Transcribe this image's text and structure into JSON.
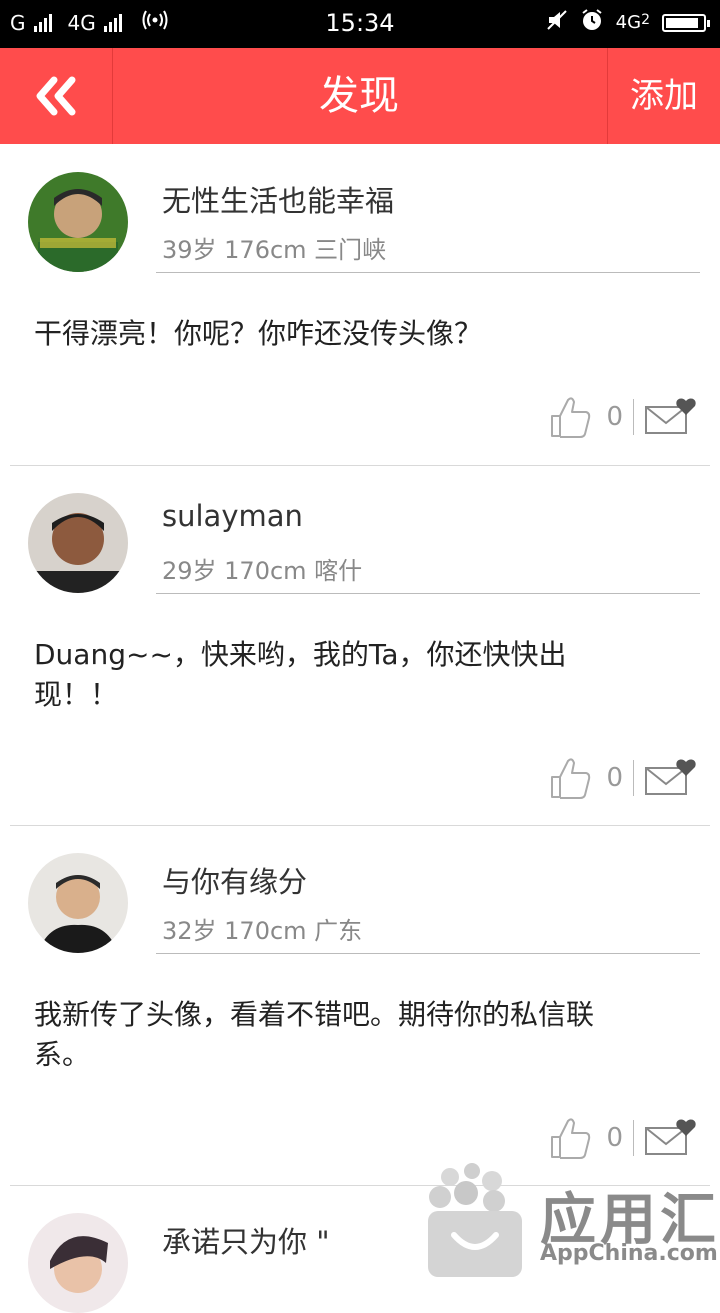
{
  "status_bar": {
    "carrier1": "G",
    "carrier2": "4G",
    "time": "15:34",
    "network_right": "4G",
    "network_right_sub": "2",
    "battery_level": 0.9
  },
  "header": {
    "title": "发现",
    "add_label": "添加"
  },
  "posts": [
    {
      "name": "无性生活也能幸福",
      "meta": "39岁  176cm  三门峡",
      "content": "干得漂亮！你呢？你咋还没传头像？",
      "likes": "0"
    },
    {
      "name": "sulayman",
      "meta": "29岁  170cm  喀什",
      "content": "Duang~~，快来哟，我的Ta，你还快快出现！！",
      "likes": "0"
    },
    {
      "name": "与你有缘分",
      "meta": "32岁  170cm  广东",
      "content": "我新传了头像，看着不错吧。期待你的私信联系。",
      "likes": "0"
    },
    {
      "name": "承诺只为你 \"",
      "meta": "",
      "content": "",
      "likes": ""
    }
  ],
  "watermark": {
    "text": "应用汇",
    "sub": "AppChina.com"
  },
  "colors": {
    "accent": "#ff4c4c",
    "status_bg": "#000000"
  }
}
